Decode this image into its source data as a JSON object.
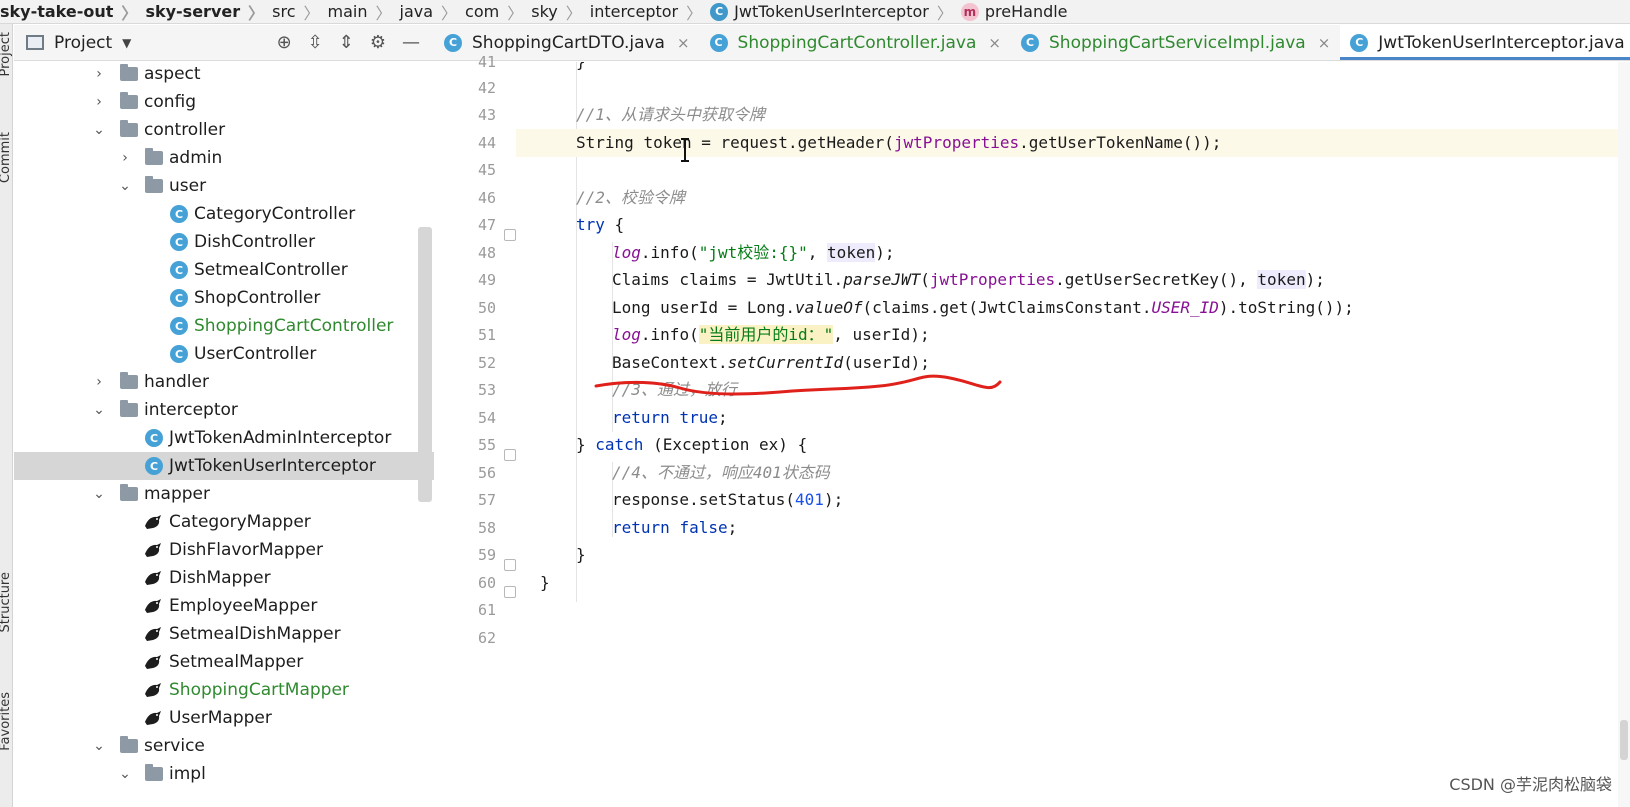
{
  "breadcrumb": {
    "items": [
      "sky-take-out",
      "sky-server",
      "src",
      "main",
      "java",
      "com",
      "sky",
      "interceptor",
      "JwtTokenUserInterceptor",
      "preHandle"
    ]
  },
  "side_tabs": {
    "project": "Project",
    "commit": "Commit",
    "structure": "Structure",
    "favorites": "Favorites"
  },
  "project_panel": {
    "title": "Project"
  },
  "tree": {
    "aspect": "aspect",
    "config": "config",
    "controller": "controller",
    "admin": "admin",
    "user": "user",
    "category_controller": "CategoryController",
    "dish_controller": "DishController",
    "setmeal_controller": "SetmealController",
    "shop_controller": "ShopController",
    "shopping_cart_controller": "ShoppingCartController",
    "user_controller": "UserController",
    "handler": "handler",
    "interceptor": "interceptor",
    "jwt_admin": "JwtTokenAdminInterceptor",
    "jwt_user": "JwtTokenUserInterceptor",
    "mapper": "mapper",
    "category_mapper": "CategoryMapper",
    "dish_flavor_mapper": "DishFlavorMapper",
    "dish_mapper": "DishMapper",
    "employee_mapper": "EmployeeMapper",
    "setmeal_dish_mapper": "SetmealDishMapper",
    "setmeal_mapper": "SetmealMapper",
    "shopping_cart_mapper": "ShoppingCartMapper",
    "user_mapper": "UserMapper",
    "service": "service",
    "impl": "impl"
  },
  "tabs": {
    "t1": "ShoppingCartDTO.java",
    "t2": "ShoppingCartController.java",
    "t3": "ShoppingCartServiceImpl.java",
    "t4": "JwtTokenUserInterceptor.java",
    "close": "×"
  },
  "editor": {
    "line_numbers": [
      "41",
      "42",
      "43",
      "44",
      "45",
      "46",
      "47",
      "48",
      "49",
      "50",
      "51",
      "52",
      "53",
      "54",
      "55",
      "56",
      "57",
      "58",
      "59",
      "60",
      "61",
      "62"
    ],
    "comment1": "//1、从请求头中获取令牌",
    "comment2": "//2、校验令牌",
    "comment3": "//3、通过，放行",
    "comment4": "//4、不通过，响应401状态码",
    "brace_close": "}",
    "string_kw": "String",
    "token_var": "token",
    "eq": " = request.getHeader(",
    "jwt_props": "jwtProperties",
    "get_user_token_name": ".getUserTokenName());",
    "try_kw": "try",
    "open_brace": " {",
    "log": "log",
    "info_open": ".info(",
    "jwt_str": "\"jwt校验:{}\"",
    "comma_sp": ", ",
    "close_semi": ");",
    "claims_decl": "Claims claims = JwtUtil.",
    "parse_jwt": "parseJWT",
    "paren_open": "(",
    "get_secret": ".getUserSecretKey(), ",
    "long_decl": "Long userId = Long.",
    "value_of": "valueOf",
    "claims_get": "(claims.get(JwtClaimsConstant.",
    "user_id_const": "USER_ID",
    "to_string": ").toString());",
    "current_user_str": "\"当前用户的id：\"",
    "user_id_arg": ", userId);",
    "base_ctx": "BaseContext.",
    "set_current_id": "setCurrentId",
    "set_arg": "(userId);",
    "return_kw": "return",
    "true_kw": "true",
    "false_kw": "false",
    "semi": ";",
    "catch_open": "} ",
    "catch_kw": "catch",
    "catch_rest": " (Exception ex) {",
    "set_status": "response.setStatus(",
    "status_code": "401"
  },
  "watermark": "CSDN @芋泥肉松脑袋",
  "colors": {
    "keyword": "#0033b3",
    "string": "#067d17",
    "field": "#871094",
    "comment": "#8c8c8c",
    "annotation_red": "#e0201a"
  }
}
